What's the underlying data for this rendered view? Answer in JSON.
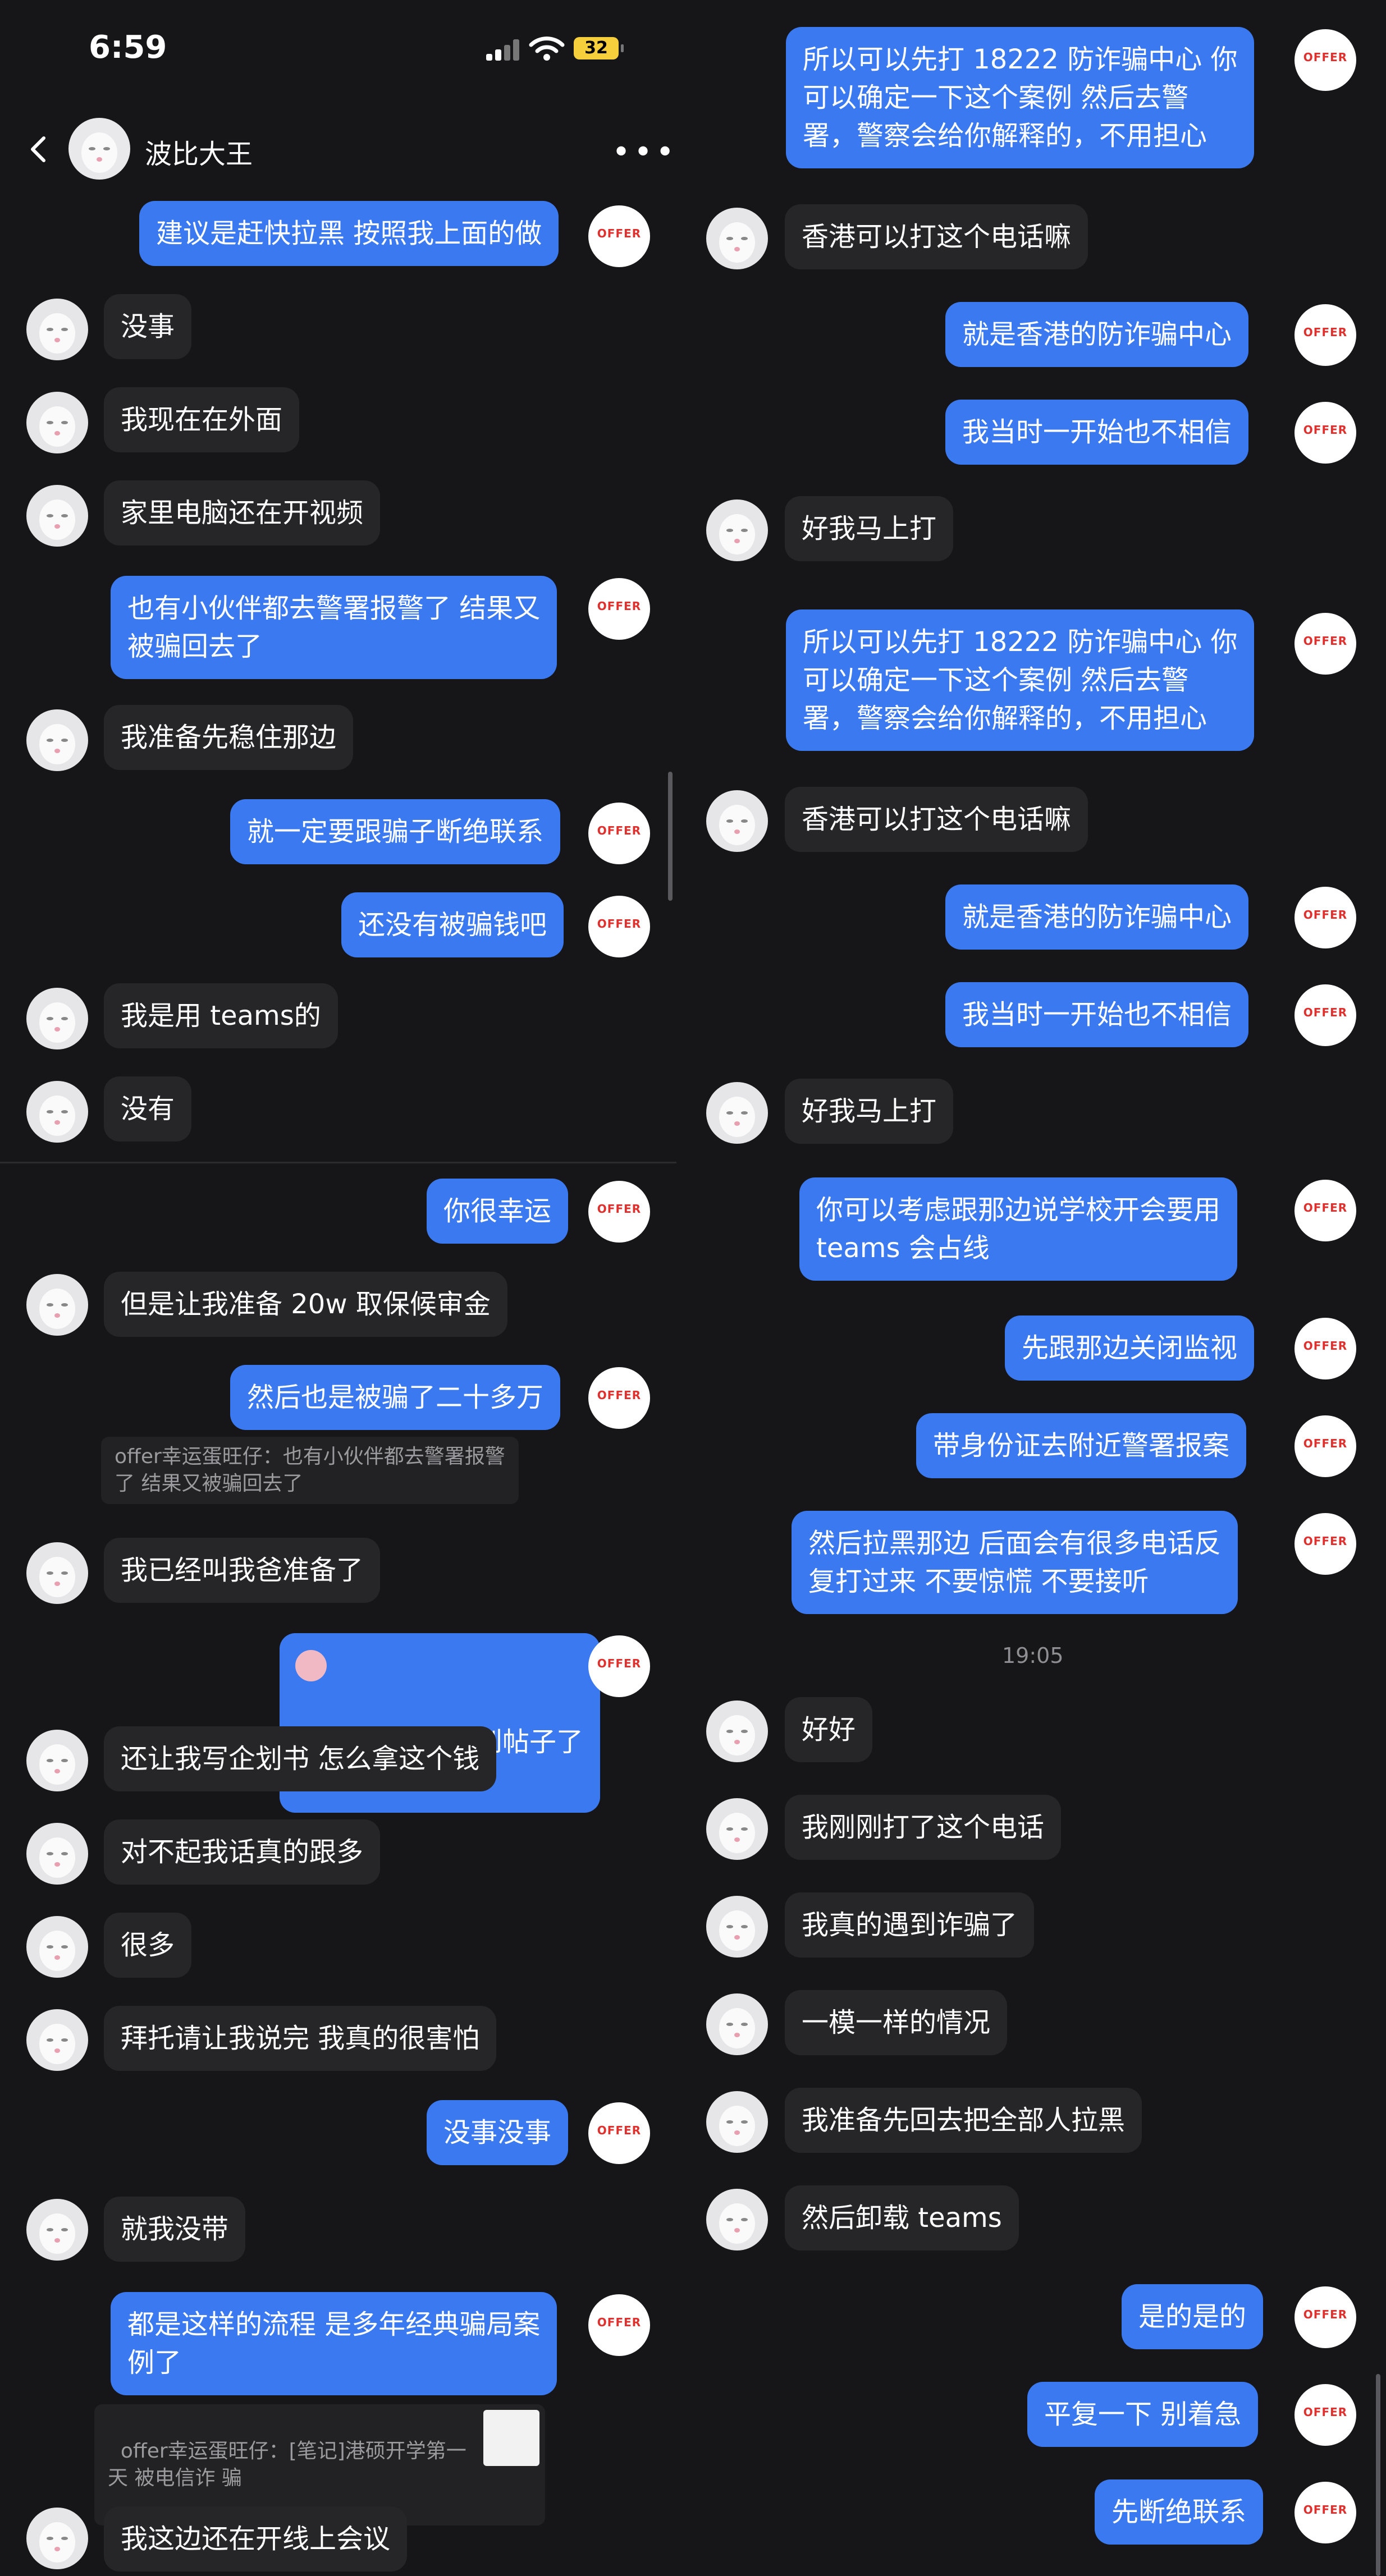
{
  "status": {
    "time": "6:59",
    "battery": "32"
  },
  "header": {
    "name": "波比大王"
  },
  "avatar": {
    "offer_label": "OFFER"
  },
  "left_messages": [
    {
      "text": "建议是赶快拉黑 按照我上面的做"
    },
    {
      "text": "没事"
    },
    {
      "text": "我现在在外面"
    },
    {
      "text": "家里电脑还在开视频"
    },
    {
      "text": "也有小伙伴都去警署报警了 结果又\n被骗回去了"
    },
    {
      "text": "我准备先稳住那边"
    },
    {
      "text": "就一定要跟骗子断绝联系"
    },
    {
      "text": "还没有被骗钱吧"
    },
    {
      "text": "我是用 teams的"
    },
    {
      "text": "没有"
    },
    {
      "text": "你很幸运"
    },
    {
      "text": "但是让我准备 20w 取保候审金"
    },
    {
      "text": "然后也是被骗了二十多万"
    },
    {
      "text": "offer幸运蛋旺仔：也有小伙伴都去警署报警\n了 结果又被骗回去了"
    },
    {
      "text": "我已经叫我爸准备了"
    },
    {
      "text": "还好你刷到帖子了"
    },
    {
      "text": "还让我写企划书 怎么拿这个钱"
    },
    {
      "text": "对不起我话真的跟多"
    },
    {
      "text": "很多"
    },
    {
      "text": "拜托请让我说完 我真的很害怕"
    },
    {
      "text": "没事没事"
    },
    {
      "text": "就我没带"
    },
    {
      "text": "都是这样的流程 是多年经典骗局案\n例了"
    },
    {
      "text": "offer幸运蛋旺仔：[笔记]港硕开学第一\n天 被电信诈 骗"
    },
    {
      "text": "我这边还在开线上会议"
    }
  ],
  "right_messages": [
    {
      "text": "所以可以先打 18222 防诈骗中心 你\n可以确定一下这个案例 然后去警\n署，警察会给你解释的，不用担心"
    },
    {
      "text": "香港可以打这个电话嘛"
    },
    {
      "text": "就是香港的防诈骗中心"
    },
    {
      "text": "我当时一开始也不相信"
    },
    {
      "text": "好我马上打"
    },
    {
      "text": "所以可以先打 18222 防诈骗中心 你\n可以确定一下这个案例 然后去警\n署，警察会给你解释的，不用担心"
    },
    {
      "text": "香港可以打这个电话嘛"
    },
    {
      "text": "就是香港的防诈骗中心"
    },
    {
      "text": "我当时一开始也不相信"
    },
    {
      "text": "好我马上打"
    },
    {
      "text": "你可以考虑跟那边说学校开会要用\nteams 会占线"
    },
    {
      "text": "先跟那边关闭监视"
    },
    {
      "text": "带身份证去附近警署报案"
    },
    {
      "text": "然后拉黑那边 后面会有很多电话反\n复打过来 不要惊慌 不要接听"
    },
    {
      "text": "19:05"
    },
    {
      "text": "好好"
    },
    {
      "text": "我刚刚打了这个电话"
    },
    {
      "text": "我真的遇到诈骗了"
    },
    {
      "text": "一模一样的情况"
    },
    {
      "text": "我准备先回去把全部人拉黑"
    },
    {
      "text": "然后卸载 teams"
    },
    {
      "text": "是的是的"
    },
    {
      "text": "平复一下 别着急"
    },
    {
      "text": "先断绝联系"
    }
  ]
}
